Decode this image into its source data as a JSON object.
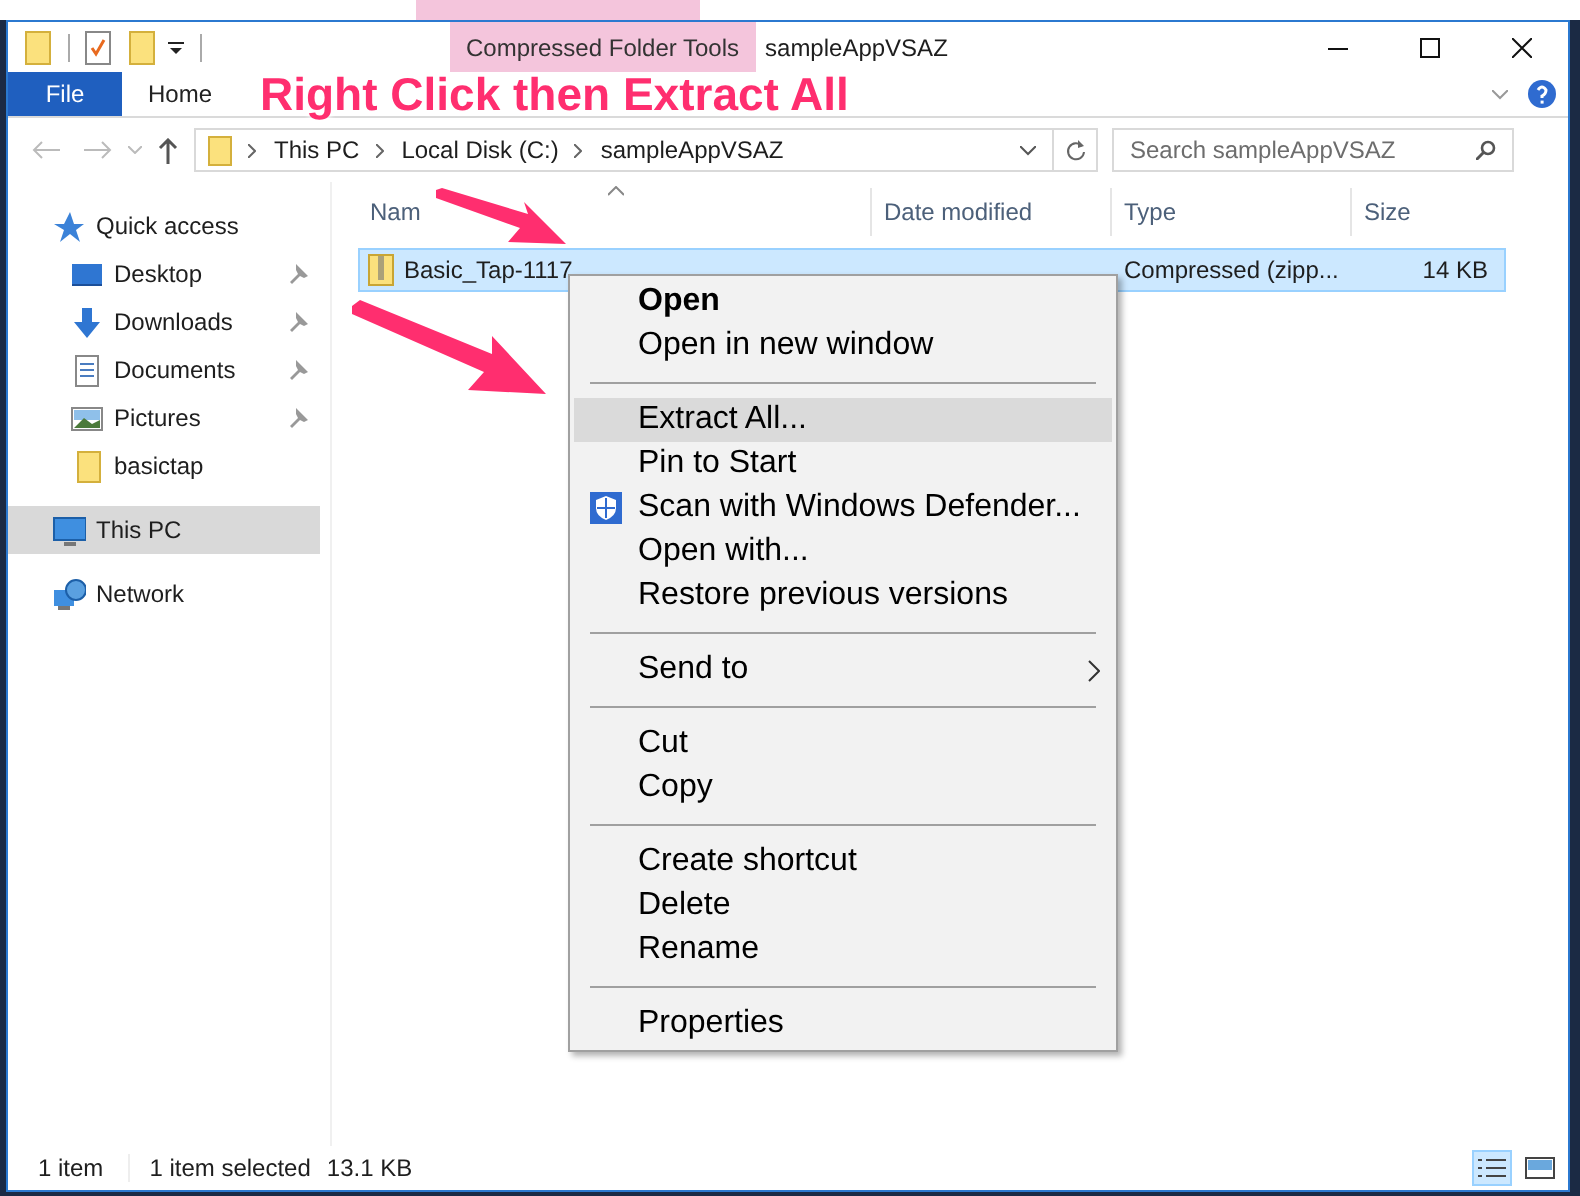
{
  "window": {
    "title": "sampleAppVSAZ"
  },
  "ribbon": {
    "context_tab": "Compressed Folder Tools",
    "tabs": [
      {
        "label": "File",
        "kind": "file"
      },
      {
        "label": "Home",
        "kind": "tab"
      }
    ]
  },
  "address": {
    "crumbs": [
      "This PC",
      "Local Disk (C:)",
      "sampleAppVSAZ"
    ]
  },
  "search": {
    "placeholder": "Search sampleAppVSAZ"
  },
  "nav": {
    "items": [
      {
        "label": "Quick access",
        "kind": "star",
        "pinned": false,
        "selected": false,
        "children": [
          {
            "label": "Desktop",
            "kind": "desktop",
            "pinned": true,
            "selected": false
          },
          {
            "label": "Downloads",
            "kind": "download",
            "pinned": true,
            "selected": false
          },
          {
            "label": "Documents",
            "kind": "document",
            "pinned": true,
            "selected": false
          },
          {
            "label": "Pictures",
            "kind": "pictures",
            "pinned": true,
            "selected": false
          },
          {
            "label": "basictap",
            "kind": "folder",
            "pinned": false,
            "selected": false
          }
        ]
      },
      {
        "label": "This PC",
        "kind": "pc",
        "pinned": false,
        "selected": true
      },
      {
        "label": "Network",
        "kind": "network",
        "pinned": false,
        "selected": false
      }
    ]
  },
  "columns": [
    "Nam",
    "Date modified",
    "Type",
    "Size"
  ],
  "rows": [
    {
      "name": "Basic_Tap-1117",
      "type": "Compressed (zipp...",
      "size": "14 KB",
      "selected": true
    }
  ],
  "context_menu": {
    "items": [
      {
        "kind": "item",
        "label": "Open",
        "default": true,
        "highlighted": false
      },
      {
        "kind": "item",
        "label": "Open in new window",
        "default": false,
        "highlighted": false
      },
      {
        "kind": "separator"
      },
      {
        "kind": "item",
        "label": "Extract All...",
        "default": false,
        "highlighted": true
      },
      {
        "kind": "item",
        "label": "Pin to Start",
        "default": false,
        "highlighted": false
      },
      {
        "kind": "shield-item",
        "label": "Scan with Windows Defender...",
        "default": false,
        "highlighted": false
      },
      {
        "kind": "item",
        "label": "Open with...",
        "default": false,
        "highlighted": false
      },
      {
        "kind": "item",
        "label": "Restore previous versions",
        "default": false,
        "highlighted": false
      },
      {
        "kind": "separator"
      },
      {
        "kind": "item",
        "label": "Send to",
        "default": false,
        "highlighted": false,
        "submenu": true
      },
      {
        "kind": "separator"
      },
      {
        "kind": "item",
        "label": "Cut",
        "default": false,
        "highlighted": false
      },
      {
        "kind": "item",
        "label": "Copy",
        "default": false,
        "highlighted": false
      },
      {
        "kind": "separator"
      },
      {
        "kind": "item",
        "label": "Create shortcut",
        "default": false,
        "highlighted": false
      },
      {
        "kind": "item",
        "label": "Delete",
        "default": false,
        "highlighted": false
      },
      {
        "kind": "item",
        "label": "Rename",
        "default": false,
        "highlighted": false
      },
      {
        "kind": "separator"
      },
      {
        "kind": "item",
        "label": "Properties",
        "default": false,
        "highlighted": false
      }
    ]
  },
  "annotation": {
    "text": "Right Click then Extract All"
  },
  "status_bar": {
    "count": "1 item",
    "selection": "1 item selected",
    "size": "13.1 KB",
    "views": [
      {
        "kind": "details",
        "selected": true
      },
      {
        "kind": "large-icons",
        "selected": false
      }
    ]
  }
}
